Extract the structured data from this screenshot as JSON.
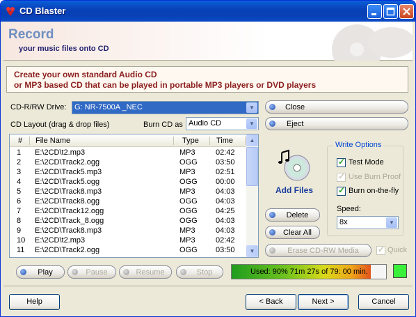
{
  "window": {
    "title": "CD Blaster"
  },
  "header": {
    "title": "Record",
    "subtitle": "your music files onto CD"
  },
  "banner": {
    "line1": "Create your own standard Audio CD",
    "line2": "or MP3 based CD that can be played in portable MP3 players or DVD players"
  },
  "drive": {
    "label": "CD-R/RW Drive:",
    "value": "G: NR-7500A        _NEC"
  },
  "layout": {
    "label": "CD Layout (drag & drop files)",
    "burn_as_label": "Burn CD as",
    "burn_as_value": "Audio CD"
  },
  "list": {
    "columns": [
      "#",
      "File Name",
      "Type",
      "Time"
    ],
    "rows": [
      [
        "1",
        "E:\\2CD\\t2.mp3",
        "MP3",
        "02:42"
      ],
      [
        "2",
        "E:\\2CD\\Track2.ogg",
        "OGG",
        "03:50"
      ],
      [
        "3",
        "E:\\2CD\\Track5.mp3",
        "MP3",
        "02:51"
      ],
      [
        "4",
        "E:\\2CD\\Track5.ogg",
        "OGG",
        "00:00"
      ],
      [
        "5",
        "E:\\2CD\\Track8.mp3",
        "MP3",
        "04:03"
      ],
      [
        "6",
        "E:\\2CD\\Track8.ogg",
        "OGG",
        "04:03"
      ],
      [
        "7",
        "E:\\2CD\\Track12.ogg",
        "OGG",
        "04:25"
      ],
      [
        "8",
        "E:\\2CD\\Track_8.ogg",
        "OGG",
        "04:03"
      ],
      [
        "9",
        "E:\\2CD\\Track8.mp3",
        "MP3",
        "04:03"
      ],
      [
        "10",
        "E:\\2CD\\t2.mp3",
        "MP3",
        "02:42"
      ],
      [
        "11",
        "E:\\2CD\\Track2.ogg",
        "OGG",
        "03:50"
      ]
    ]
  },
  "buttons": {
    "close": "Close",
    "eject": "Eject",
    "add_files": "Add Files",
    "delete": "Delete",
    "clear_all": "Clear All",
    "erase": "Erase CD-RW Media",
    "quick": "Quick",
    "play": "Play",
    "pause": "Pause",
    "resume": "Resume",
    "stop": "Stop"
  },
  "write_options": {
    "title": "Write Options",
    "test_mode": "Test Mode",
    "use_burn_proof": "Use Burn Proof",
    "burn_on_the_fly": "Burn on-the-fly",
    "speed_label": "Speed:",
    "speed_value": "8x",
    "test_mode_checked": true,
    "use_burn_proof_checked": true,
    "burn_on_the_fly_checked": true
  },
  "usage": {
    "text": "Used: 90%  71m 27s of 79: 00 min.",
    "fraction": 0.9
  },
  "footer": {
    "help": "Help",
    "back": "< Back",
    "next": "Next >",
    "cancel": "Cancel"
  },
  "colors": {
    "title_bar": "#0842b8",
    "header_title": "#6e8fc0",
    "banner_text": "#8b1e1e",
    "add_files": "#1b3d9c"
  }
}
